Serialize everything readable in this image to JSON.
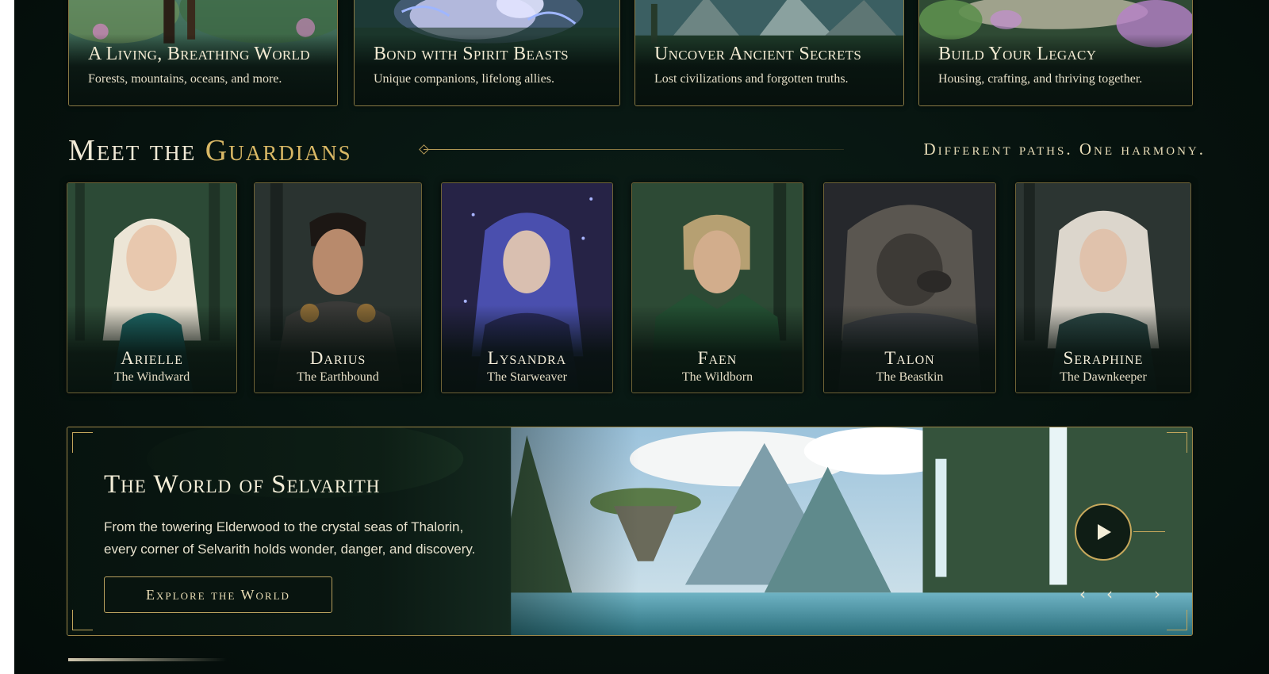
{
  "features": [
    {
      "title": "A Living, Breathing World",
      "subtitle": "Forests, mountains, oceans, and more."
    },
    {
      "title": "Bond with Spirit Beasts",
      "subtitle": "Unique companions, lifelong allies."
    },
    {
      "title": "Uncover Ancient Secrets",
      "subtitle": "Lost civilizations and forgotten truths."
    },
    {
      "title": "Build Your Legacy",
      "subtitle": "Housing, crafting, and thriving together."
    }
  ],
  "guardians_section": {
    "title_prefix": "Meet the",
    "title_highlight": "Guardians",
    "tagline": "Different paths. One harmony."
  },
  "guardians": [
    {
      "name": "Arielle",
      "role": "The Windward"
    },
    {
      "name": "Darius",
      "role": "The Earthbound"
    },
    {
      "name": "Lysandra",
      "role": "The Starweaver"
    },
    {
      "name": "Faen",
      "role": "The Wildborn"
    },
    {
      "name": "Talon",
      "role": "The Beastkin"
    },
    {
      "name": "Seraphine",
      "role": "The Dawnkeeper"
    }
  ],
  "world": {
    "title": "The World of Selvarith",
    "description_line1": "From the towering Elderwood to the crystal seas of Thalorin,",
    "description_line2": "every corner of Selvarith holds wonder, danger, and discovery.",
    "button_label": "Explore the World",
    "prev_icon": "‹",
    "next_icon": "›"
  },
  "colors": {
    "accent_gold": "#d9b865",
    "background": "#06120e",
    "frame_border": "#8a7a44"
  }
}
